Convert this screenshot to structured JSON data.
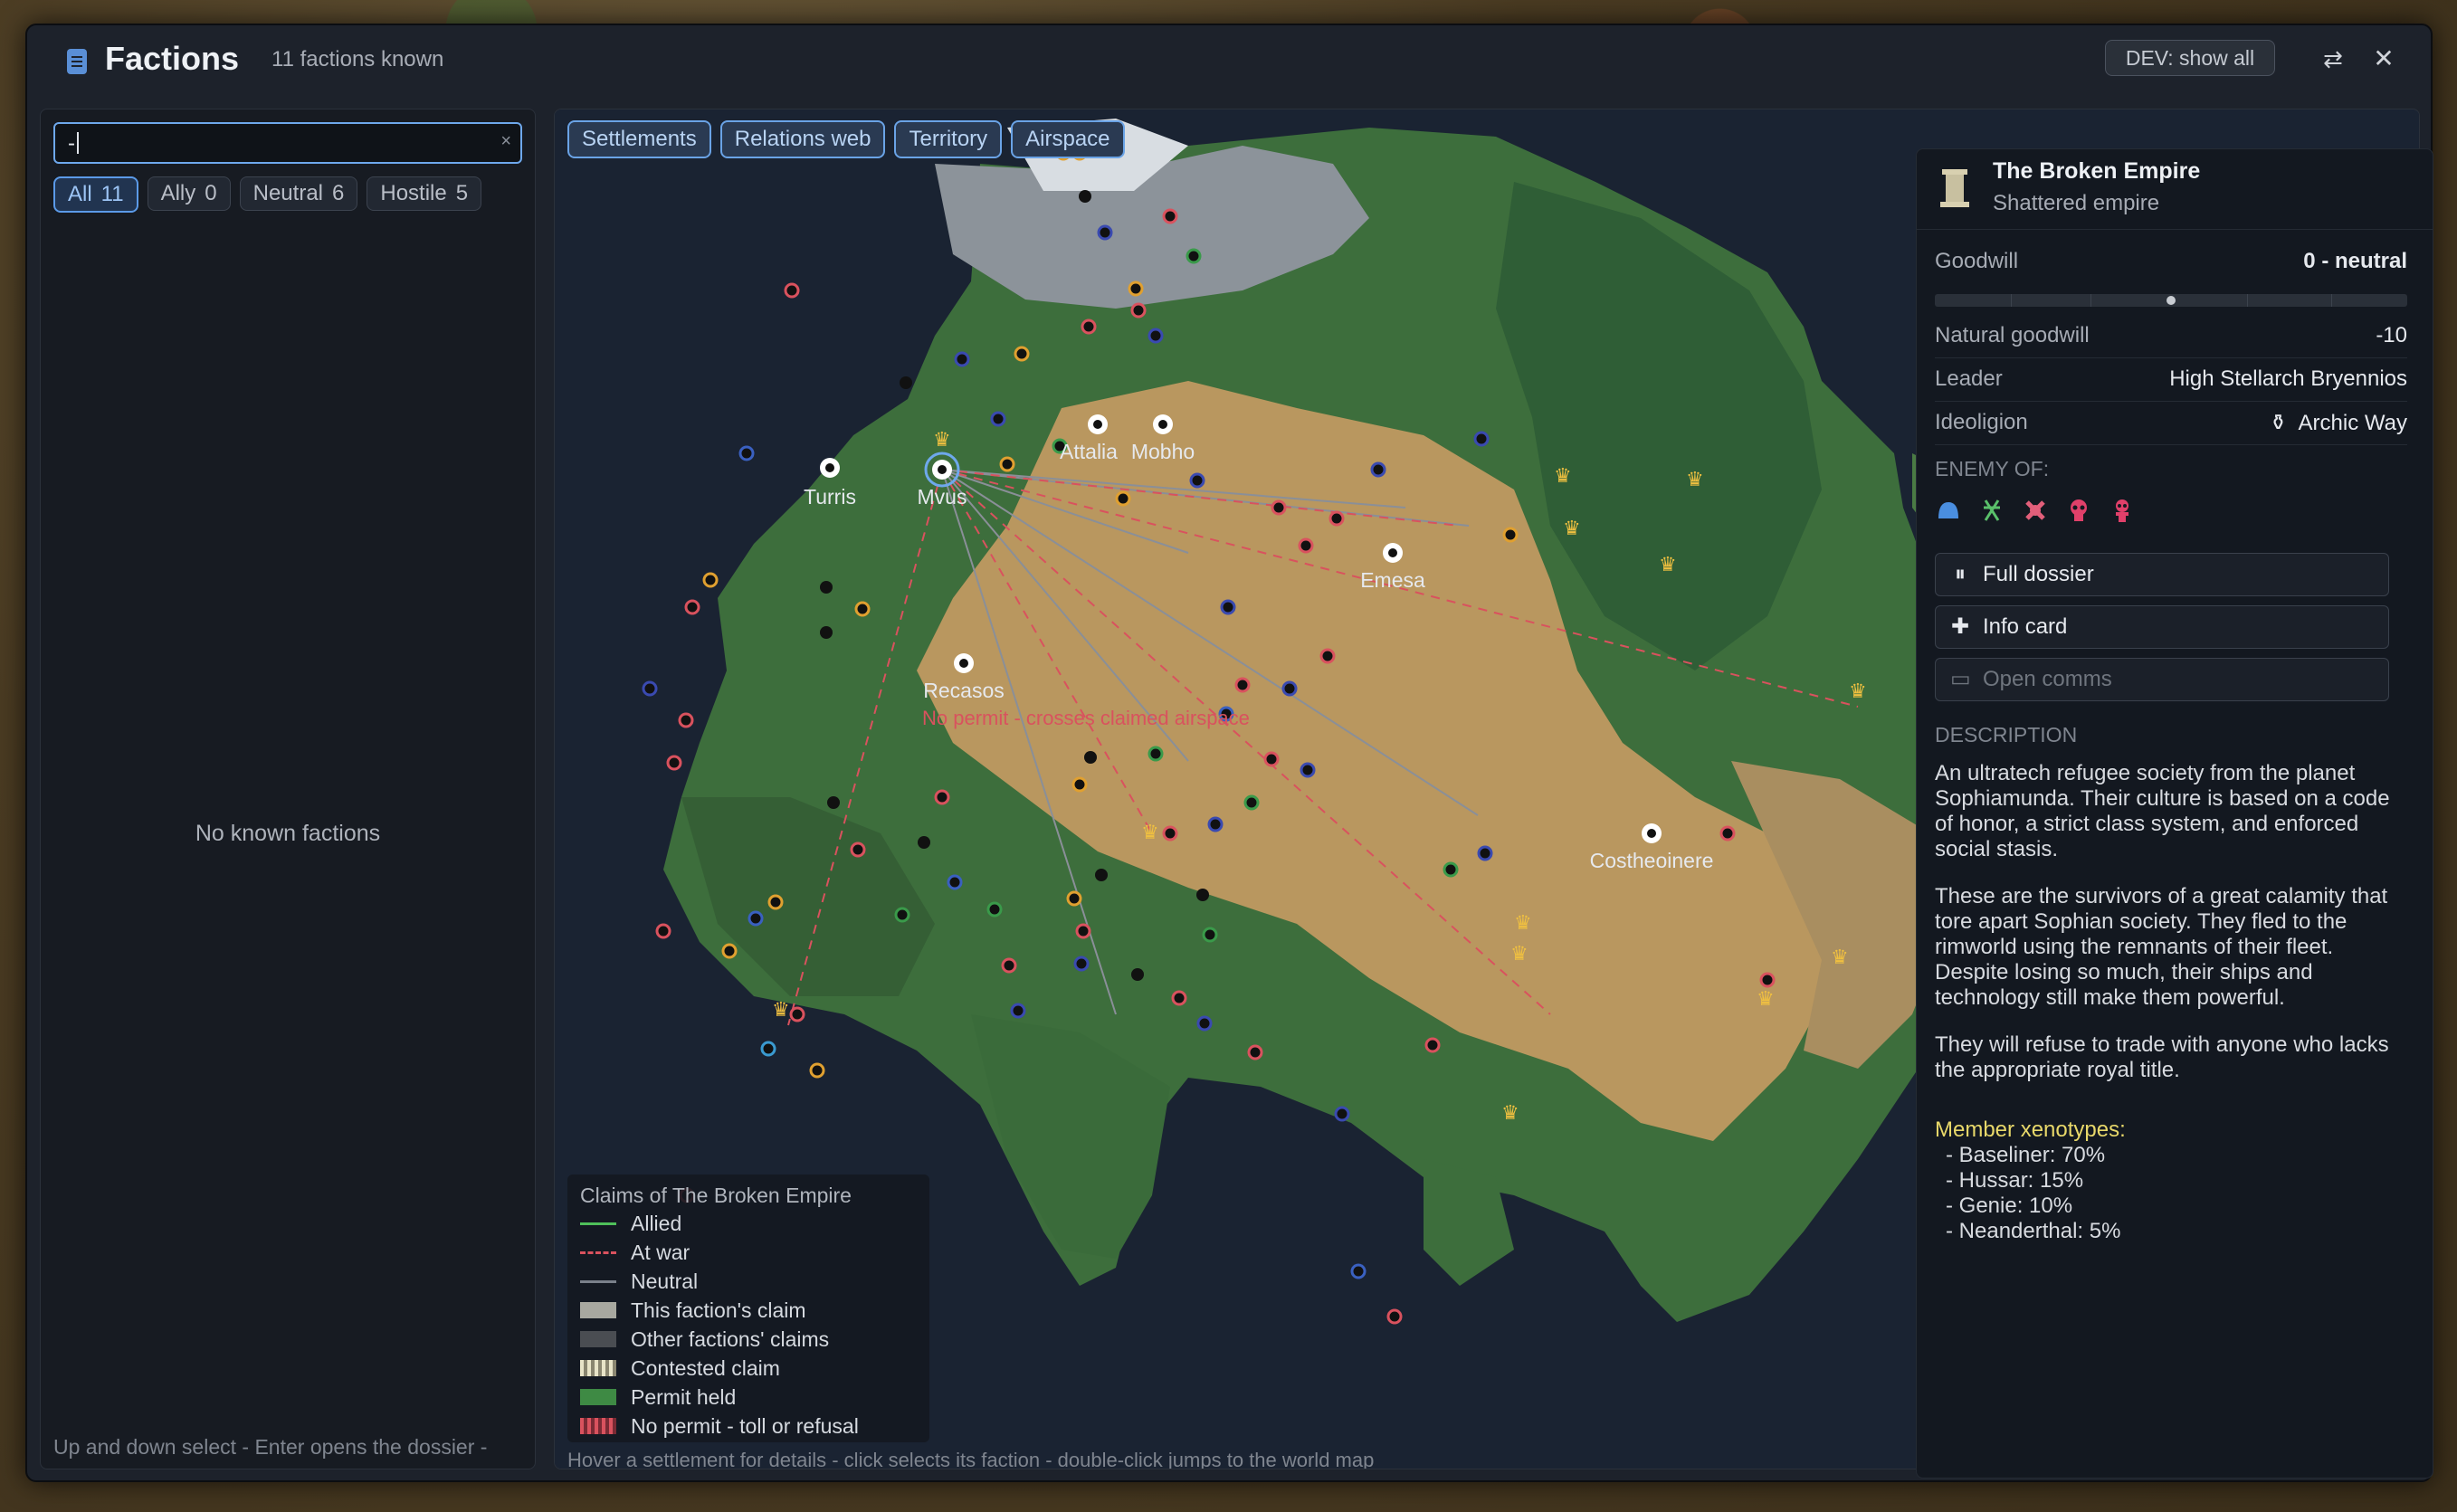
{
  "window": {
    "title": "Factions",
    "subtitle": "11 factions known",
    "dev_button": "DEV: show all",
    "swap_icon": "⇄",
    "close_icon": "✕"
  },
  "left": {
    "search_value": "-",
    "search_clear": "×",
    "filters": [
      {
        "label": "All",
        "count": "11",
        "active": true
      },
      {
        "label": "Ally",
        "count": "0"
      },
      {
        "label": "Neutral",
        "count": "6"
      },
      {
        "label": "Hostile",
        "count": "5"
      }
    ],
    "empty_text": "No known factions",
    "hint": "Up and down select - Enter opens the dossier -"
  },
  "map": {
    "tabs": [
      "Settlements",
      "Relations web",
      "Territory",
      "Airspace"
    ],
    "settlements": [
      "Turris",
      "Mvus",
      "Attalia",
      "Mobho",
      "Emesa",
      "Recasos",
      "Costheoinere"
    ],
    "warning": "No permit - crosses claimed airspace",
    "legend": {
      "title": "Claims of The Broken Empire",
      "items": [
        "Allied",
        "At war",
        "Neutral",
        "This faction's claim",
        "Other factions' claims",
        "Contested claim",
        "Permit held",
        "No permit - toll or refusal"
      ]
    },
    "hint": "Hover a settlement for details - click selects its faction - double-click jumps to the world map",
    "colors": {
      "ally": "#4fc05a",
      "war": "#d9525e",
      "neutral": "#7a808a",
      "permit": "#3e8a44",
      "nopermit": "#c8495a",
      "claim": "#a8a8a0"
    }
  },
  "detail": {
    "name": "The Broken Empire",
    "type": "Shattered empire",
    "goodwill_label": "Goodwill",
    "goodwill_value": "0 - neutral",
    "goodwill_fraction": 0.5,
    "natural_goodwill_label": "Natural goodwill",
    "natural_goodwill_value": "-10",
    "leader_label": "Leader",
    "leader_value": "High Stellarch Bryennios",
    "ideoligion_label": "Ideoligion",
    "ideoligion_value": "Archic Way",
    "enemy_label": "ENEMY OF:",
    "enemy_icons": [
      "dome-icon",
      "tribe-icon",
      "insect-icon",
      "pirate-skull-icon",
      "pirate-skull-icon"
    ],
    "actions": [
      {
        "icon": "pause-icon",
        "glyph": "⏸",
        "label": "Full dossier"
      },
      {
        "icon": "plus-icon",
        "glyph": "✚",
        "label": "Info card"
      },
      {
        "icon": "comms-icon",
        "glyph": "▭",
        "label": "Open comms",
        "disabled": true
      }
    ],
    "description_label": "DESCRIPTION",
    "paragraphs": [
      "An ultratech refugee society from the planet Sophiamunda. Their culture is based on a code of honor, a strict class system, and enforced social stasis.",
      "These are the survivors of a great calamity that tore apart Sophian society. They fled to the rimworld using the remnants of their fleet. Despite losing so much, their ships and technology still make them powerful.",
      "They will refuse to trade with anyone who lacks the appropriate royal title."
    ],
    "xenotypes_label": "Member xenotypes:",
    "xenotypes": [
      "- Baseliner: 70%",
      "- Hussar: 15%",
      "- Genie: 10%",
      "- Neanderthal: 5%"
    ]
  }
}
